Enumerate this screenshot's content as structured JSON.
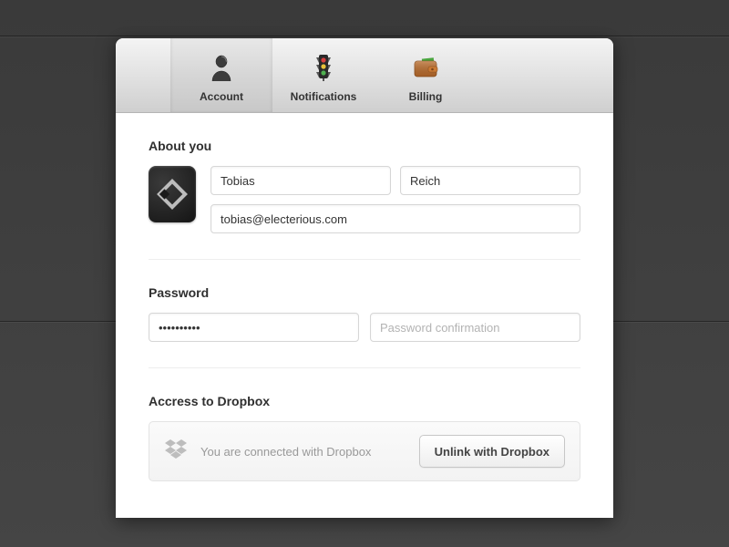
{
  "tabs": {
    "account": "Account",
    "notifications": "Notifications",
    "billing": "Billing"
  },
  "sections": {
    "about": "About you",
    "password": "Password",
    "dropbox": "Accress to Dropbox"
  },
  "fields": {
    "firstName": "Tobias",
    "lastName": "Reich",
    "email": "tobias@electerious.com",
    "password": "••••••••••",
    "passwordConfirmPlaceholder": "Password confirmation"
  },
  "dropbox": {
    "status": "You are connected with Dropbox",
    "unlinkLabel": "Unlink with Dropbox"
  }
}
